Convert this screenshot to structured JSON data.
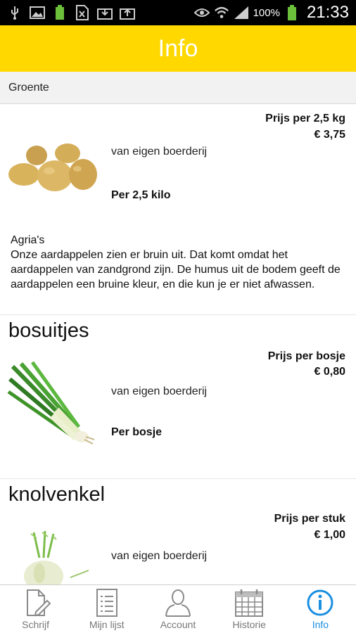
{
  "status_bar": {
    "battery_percent": "100%",
    "time": "21:33"
  },
  "header": {
    "title": "Info"
  },
  "category": {
    "label": "Groente"
  },
  "products": [
    {
      "name": "aardappelen",
      "price_label": "Prijs per 2,5 kg",
      "price": "€ 3,75",
      "origin": "van eigen boerderij",
      "unit": "Per 2,5 kilo",
      "description_title": "Agria's",
      "description": "Onze aardappelen zien er bruin uit. Dat komt omdat het aardappelen van zandgrond zijn. De humus uit de bodem geeft de aardappelen een bruine kleur, en die kun je er niet afwassen."
    },
    {
      "name": "bosuitjes",
      "price_label": "Prijs per bosje",
      "price": "€ 0,80",
      "origin": "van eigen boerderij",
      "unit": "Per bosje"
    },
    {
      "name": "knolvenkel",
      "price_label": "Prijs per stuk",
      "price": "€ 1,00",
      "origin": "van eigen boerderij"
    }
  ],
  "nav": {
    "tabs": [
      {
        "label": "Schrijf",
        "icon": "pencil-document-icon"
      },
      {
        "label": "Mijn lijst",
        "icon": "list-document-icon"
      },
      {
        "label": "Account",
        "icon": "person-icon"
      },
      {
        "label": "Historie",
        "icon": "calendar-icon"
      },
      {
        "label": "Info",
        "icon": "info-icon"
      }
    ],
    "active_color": "#1a8fe0"
  },
  "colors": {
    "header_bg": "#ffd800",
    "status_bar_bg": "#000000"
  }
}
